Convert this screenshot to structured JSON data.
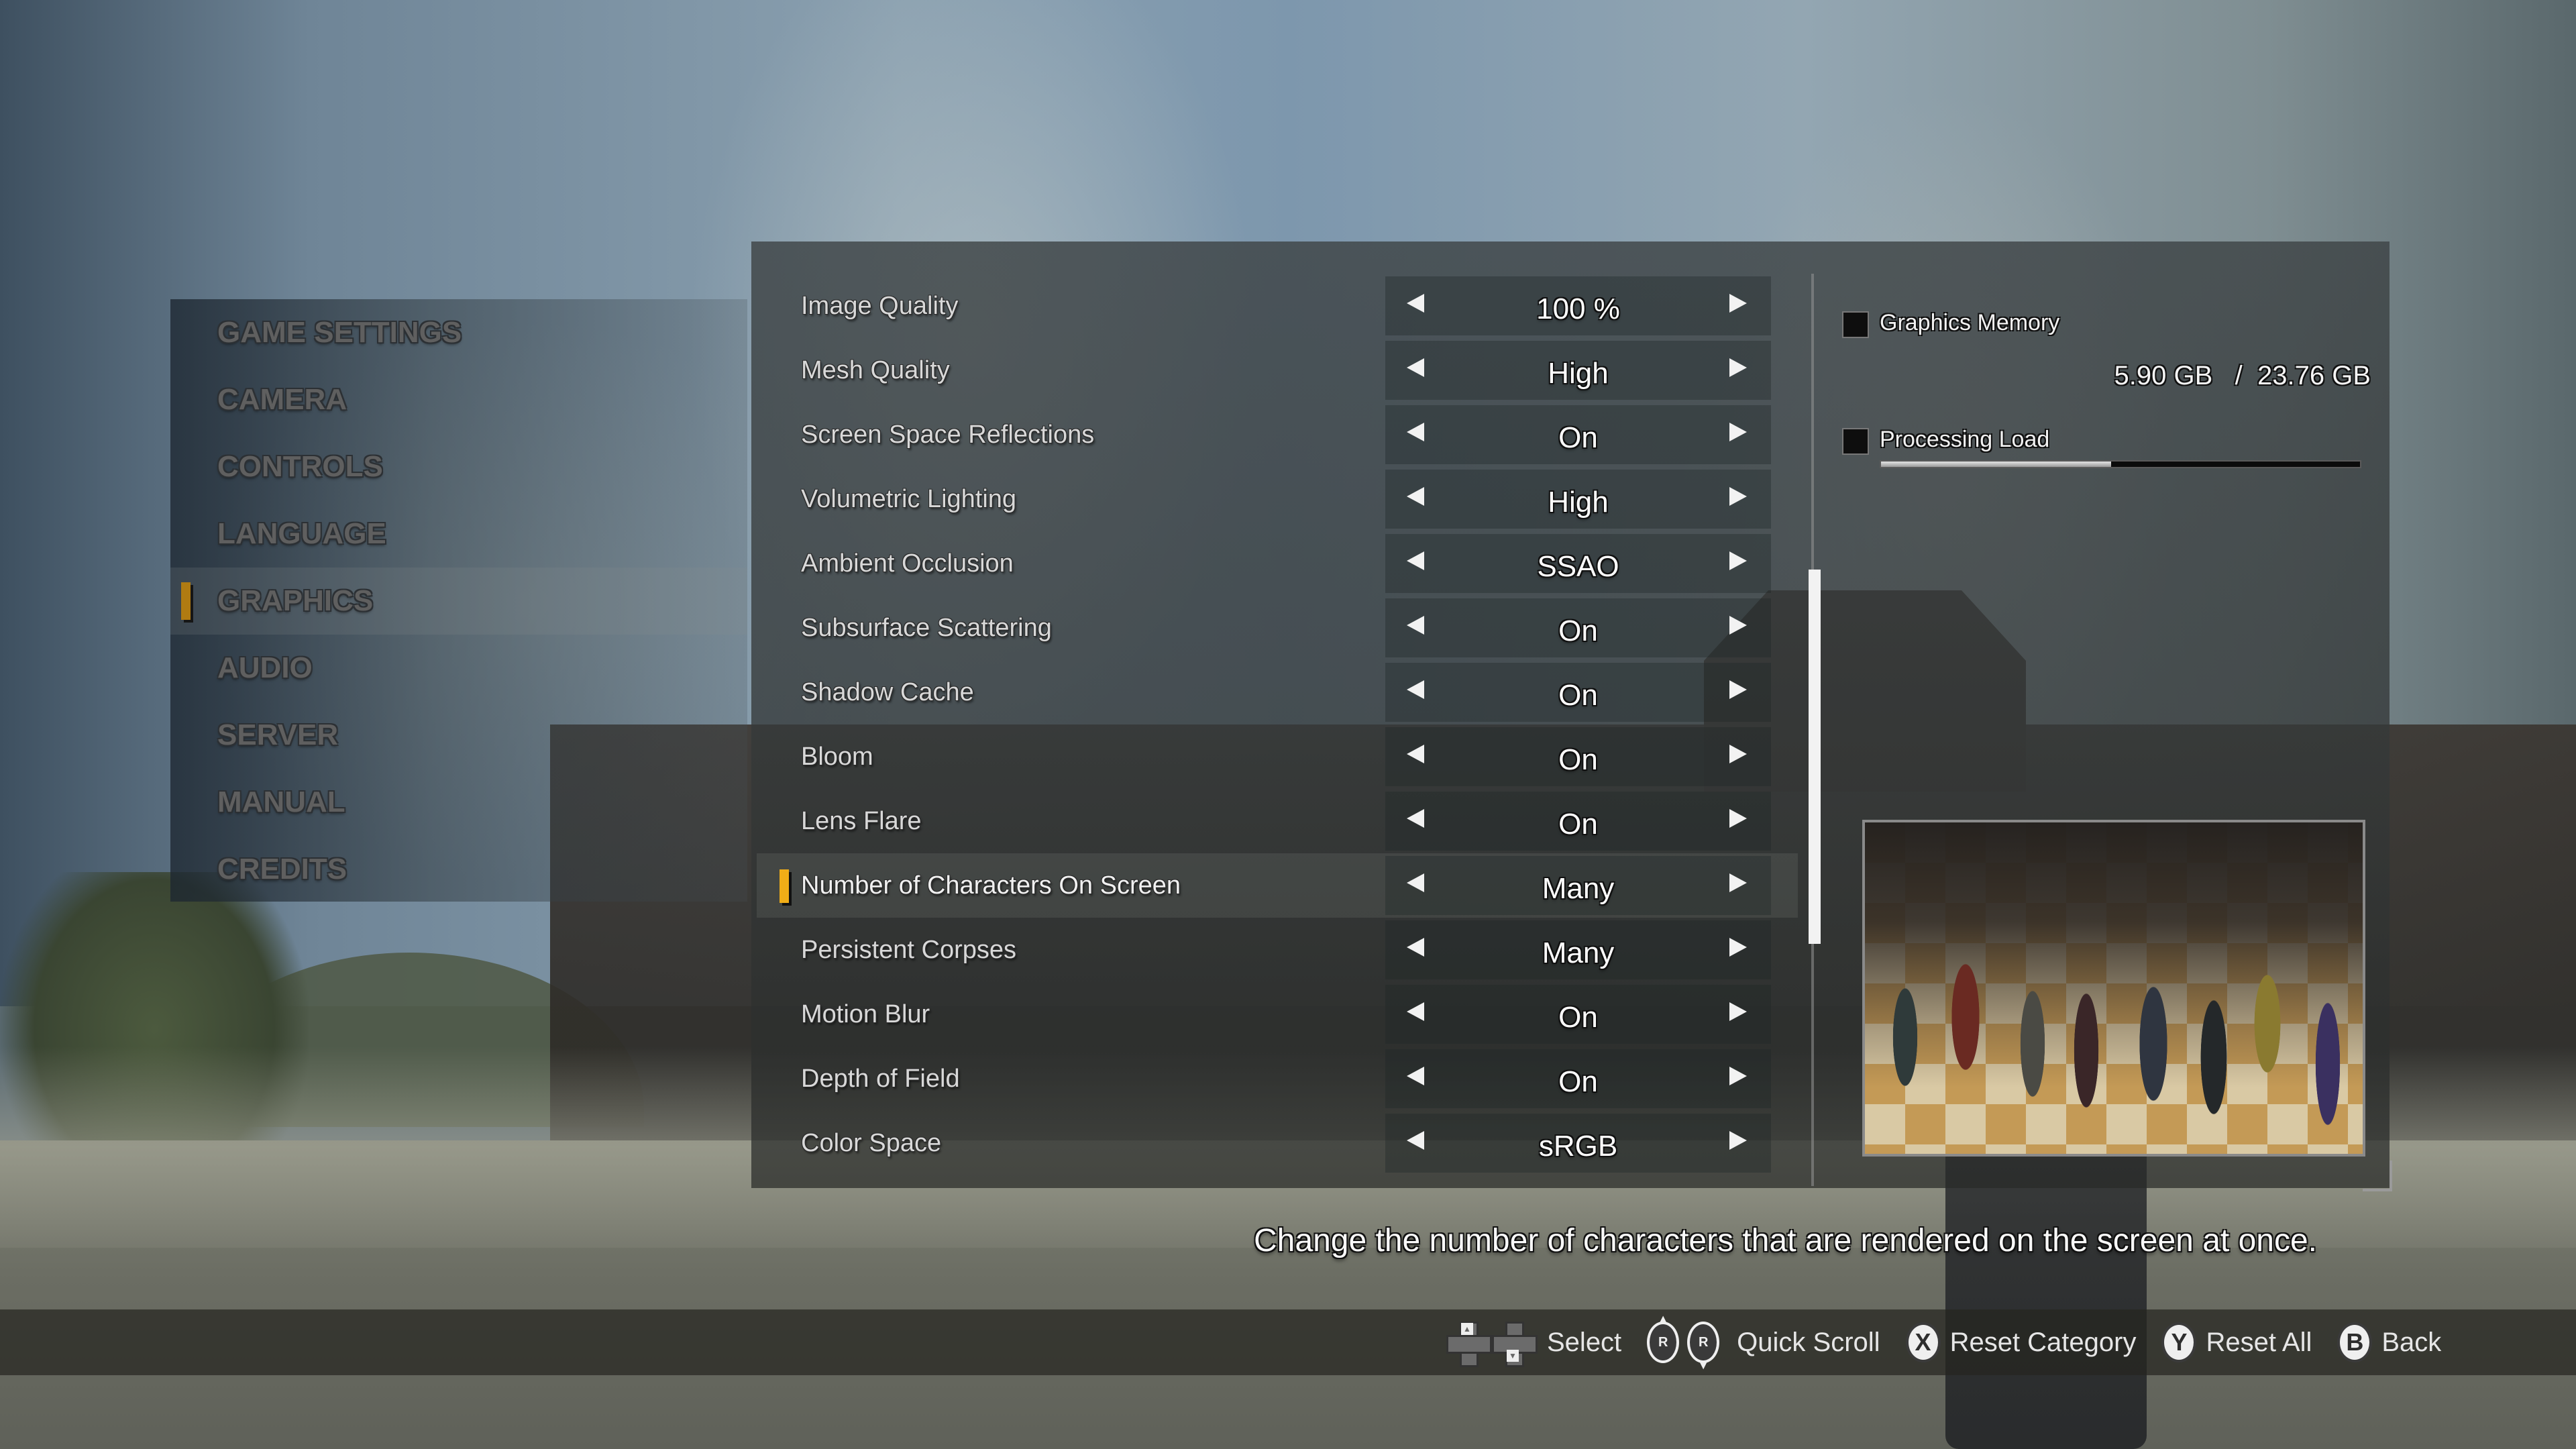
{
  "nav": {
    "items": [
      {
        "label": "GAME SETTINGS",
        "selected": false
      },
      {
        "label": "CAMERA",
        "selected": false
      },
      {
        "label": "CONTROLS",
        "selected": false
      },
      {
        "label": "LANGUAGE",
        "selected": false
      },
      {
        "label": "GRAPHICS",
        "selected": true
      },
      {
        "label": "AUDIO",
        "selected": false
      },
      {
        "label": "SERVER",
        "selected": false
      },
      {
        "label": "MANUAL",
        "selected": false
      },
      {
        "label": "CREDITS",
        "selected": false
      }
    ]
  },
  "settings": {
    "rows": [
      {
        "label": "Image Quality",
        "value": "100 %"
      },
      {
        "label": "Mesh Quality",
        "value": "High"
      },
      {
        "label": "Screen Space Reflections",
        "value": "On"
      },
      {
        "label": "Volumetric Lighting",
        "value": "High"
      },
      {
        "label": "Ambient Occlusion",
        "value": "SSAO"
      },
      {
        "label": "Subsurface Scattering",
        "value": "On"
      },
      {
        "label": "Shadow Cache",
        "value": "On"
      },
      {
        "label": "Bloom",
        "value": "On"
      },
      {
        "label": "Lens Flare",
        "value": "On"
      },
      {
        "label": "Number of Characters On Screen",
        "value": "Many",
        "selected": true
      },
      {
        "label": "Persistent Corpses",
        "value": "Many"
      },
      {
        "label": "Motion Blur",
        "value": "On"
      },
      {
        "label": "Depth of Field",
        "value": "On"
      },
      {
        "label": "Color Space",
        "value": "sRGB"
      }
    ],
    "scroll_position_fraction": 0.55,
    "scroll_visible_fraction": 0.41
  },
  "info": {
    "graphics_memory_label": "Graphics Memory",
    "memory_used": "5.90 GB",
    "memory_separator": "/",
    "memory_total": "23.76 GB",
    "processing_load_label": "Processing Load",
    "processing_load_percent": 48
  },
  "description": "Change the number of characters that are rendered on the screen at once.",
  "footer": {
    "hints": [
      {
        "icon": "dpad-up-down-icon",
        "label": "Select"
      },
      {
        "icon": "right-stick-up-down-icon",
        "label": "Quick Scroll"
      },
      {
        "icon": "x-button-icon",
        "glyph": "X",
        "label": "Reset Category"
      },
      {
        "icon": "y-button-icon",
        "glyph": "Y",
        "label": "Reset All"
      },
      {
        "icon": "b-button-icon",
        "glyph": "B",
        "label": "Back"
      }
    ]
  },
  "colors": {
    "accent": "#f0ad17",
    "nav_accent": "#b07b12",
    "value_text": "#ffffff",
    "label_text": "#d8d8d8",
    "nav_text": "#5f5f5f"
  }
}
